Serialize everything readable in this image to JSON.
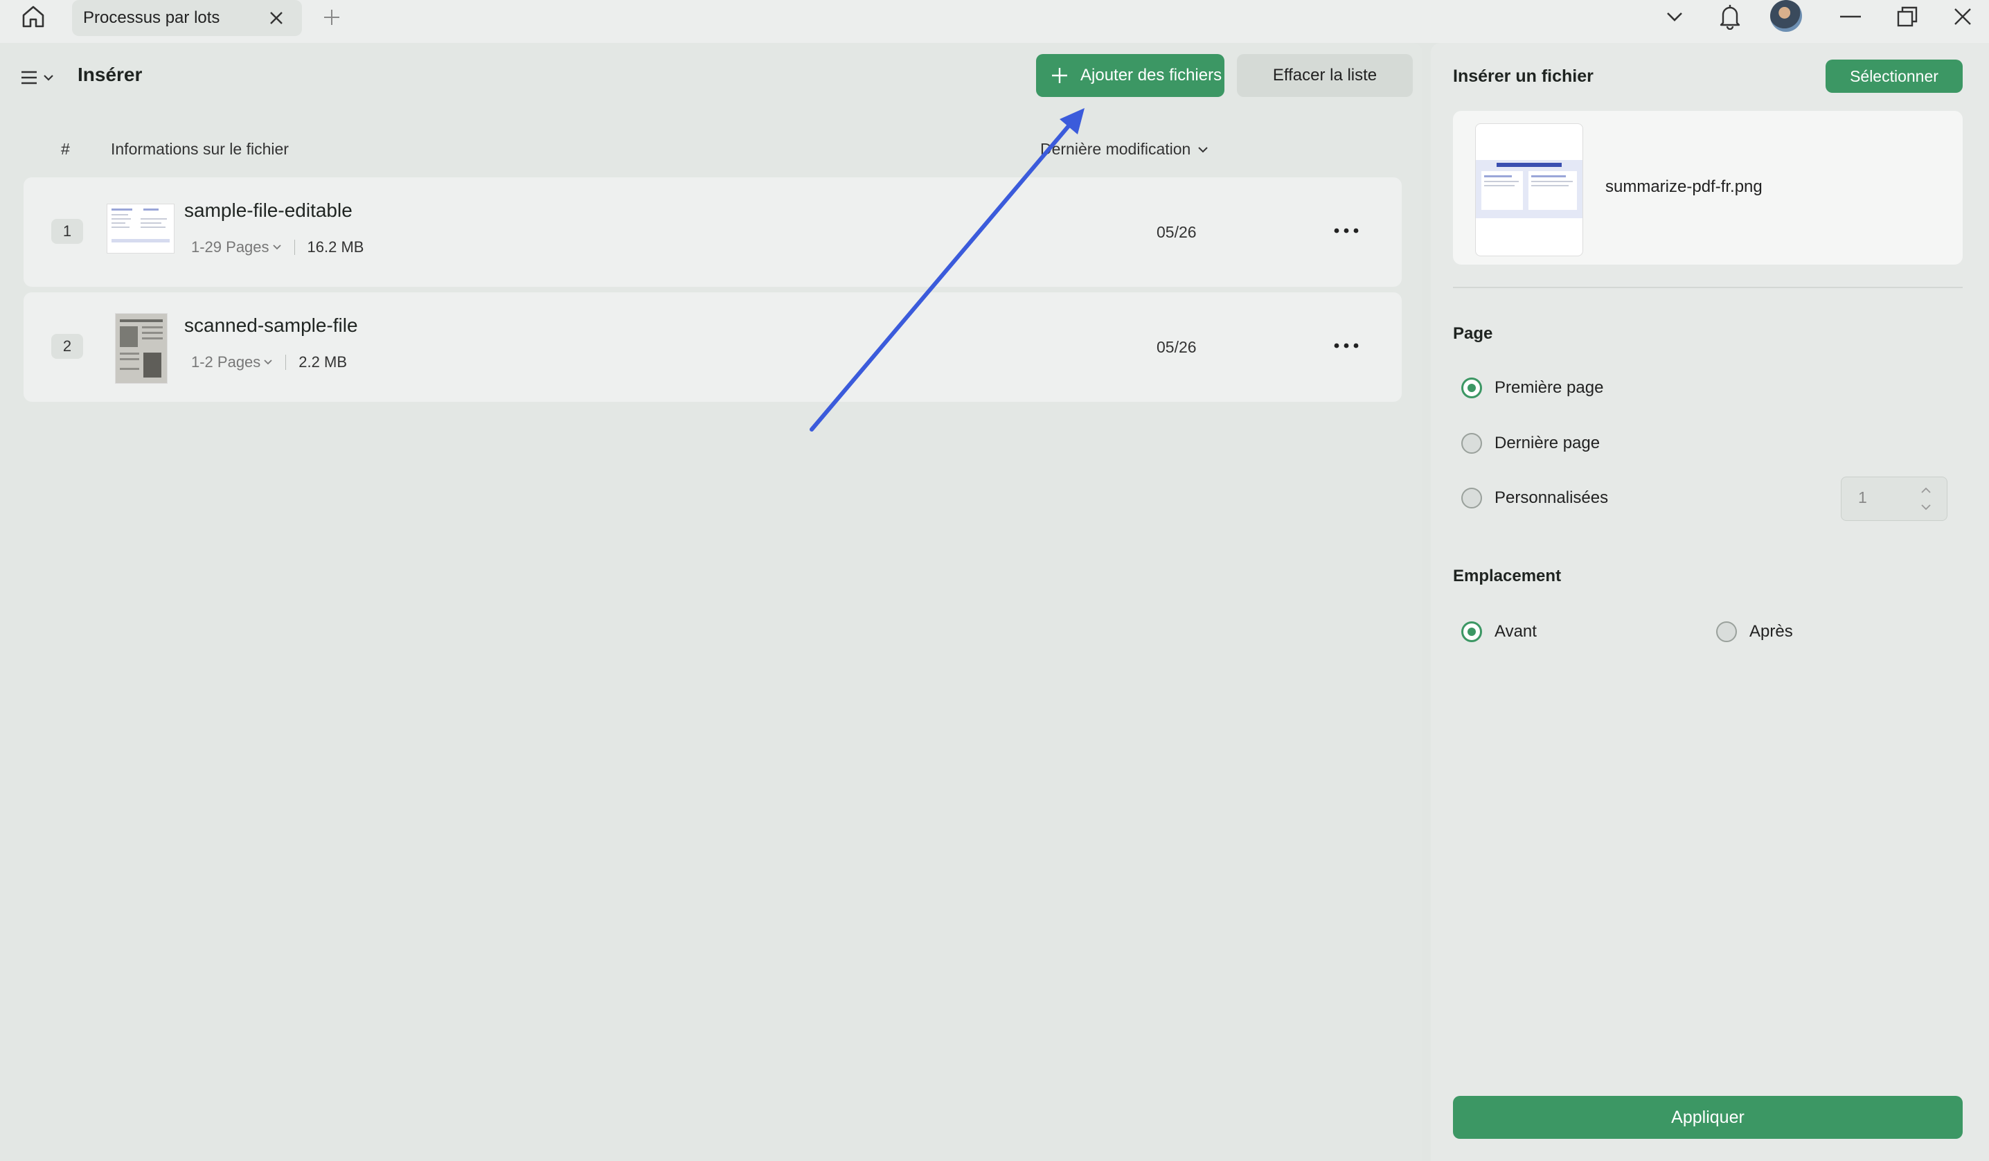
{
  "titlebar": {
    "tab_label": "Processus par lots"
  },
  "header": {
    "title": "Insérer",
    "add_files_label": "Ajouter des fichiers",
    "clear_list_label": "Effacer la liste"
  },
  "table": {
    "col_index": "#",
    "col_info": "Informations sur le fichier",
    "col_modified": "Dernière modification",
    "rows": [
      {
        "index": "1",
        "name": "sample-file-editable",
        "pages": "1-29 Pages",
        "size": "16.2 MB",
        "date": "05/26",
        "thumb_icon": "document-thumbnail-icon"
      },
      {
        "index": "2",
        "name": "scanned-sample-file",
        "pages": "1-2 Pages",
        "size": "2.2 MB",
        "date": "05/26",
        "thumb_icon": "scanned-page-thumbnail-icon"
      }
    ]
  },
  "right_panel": {
    "title": "Insérer un fichier",
    "select_label": "Sélectionner",
    "file_name": "summarize-pdf-fr.png",
    "page_section": "Page",
    "page_options": [
      {
        "label": "Première page",
        "checked": true
      },
      {
        "label": "Dernière page",
        "checked": false
      },
      {
        "label": "Personnalisées",
        "checked": false
      }
    ],
    "custom_page_value": "1",
    "location_section": "Emplacement",
    "location_options": [
      {
        "label": "Avant",
        "checked": true
      },
      {
        "label": "Après",
        "checked": false
      }
    ],
    "apply_label": "Appliquer"
  },
  "colors": {
    "accent_green": "#3c9764",
    "annotation_arrow": "#3b5bdb"
  }
}
